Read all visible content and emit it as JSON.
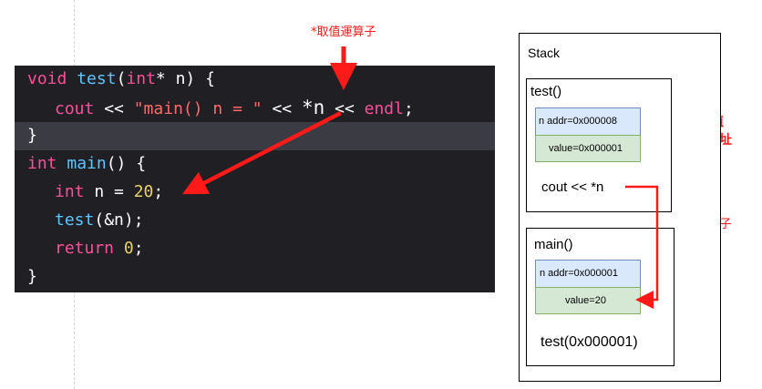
{
  "code": {
    "lines": [
      {
        "tokens": [
          "void",
          "test",
          "(",
          "int",
          "* n) {"
        ]
      },
      {
        "tokens": [
          "cout",
          " << ",
          "\"main() n = \"",
          " << ",
          "*n",
          " << ",
          "endl",
          ";"
        ]
      },
      {
        "tokens": [
          "}"
        ]
      },
      {
        "tokens": [
          "int",
          "main",
          "() {"
        ]
      },
      {
        "tokens": [
          "int",
          " n = ",
          "20",
          ";"
        ]
      },
      {
        "tokens": [
          "test",
          "(&n);"
        ]
      },
      {
        "tokens": [
          "return",
          "0",
          ";"
        ]
      },
      {
        "tokens": [
          "}"
        ]
      }
    ]
  },
  "annotations": {
    "deref_top": "*取值運算子",
    "deref_right": "*取值運算子",
    "n_value_note_line1": "n變數的值",
    "n_value_note_line2": "是記憶體位址"
  },
  "stack": {
    "title": "Stack",
    "test_frame": {
      "title": "test()",
      "addr": "n  addr=0x000008",
      "value": "value=0x000001",
      "stmt": "cout << *n"
    },
    "main_frame": {
      "title": "main()",
      "addr": "n  addr=0x000001",
      "value": "value=20",
      "call": "test(0x000001)"
    }
  },
  "colors": {
    "editor_bg": "#1f1f24",
    "highlight_line": "#3b3b44",
    "keyword": "#ff4f9b",
    "function": "#5fc4ff",
    "string": "#ff6b6b",
    "number": "#e9d26a",
    "arrow_red": "#ff1a1a",
    "addr_cell": "#dae8fc",
    "value_cell": "#d5e8d4"
  }
}
